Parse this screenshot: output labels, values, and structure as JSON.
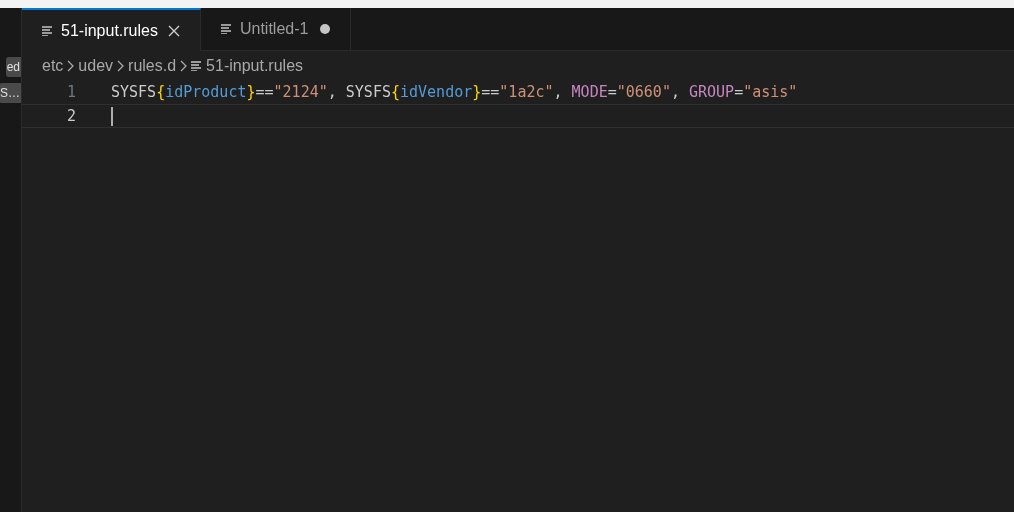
{
  "sidebar": {
    "badges": [
      "ed",
      "S…"
    ]
  },
  "tabs": [
    {
      "label": "51-input.rules",
      "selected": true,
      "modified": false
    },
    {
      "label": "Untitled-1",
      "selected": false,
      "modified": true
    }
  ],
  "breadcrumbs": [
    "etc",
    "udev",
    "rules.d",
    "51-input.rules"
  ],
  "lines": [
    {
      "number": "1",
      "current": false,
      "tokens": [
        {
          "kind": "plain",
          "text": "SYSFS"
        },
        {
          "kind": "brace",
          "text": "{"
        },
        {
          "kind": "key",
          "text": "idProduct"
        },
        {
          "kind": "brace",
          "text": "}"
        },
        {
          "kind": "plain",
          "text": "=="
        },
        {
          "kind": "string",
          "text": "\"2124\""
        },
        {
          "kind": "plain",
          "text": ", SYSFS"
        },
        {
          "kind": "brace",
          "text": "{"
        },
        {
          "kind": "key",
          "text": "idVendor"
        },
        {
          "kind": "brace",
          "text": "}"
        },
        {
          "kind": "plain",
          "text": "=="
        },
        {
          "kind": "string",
          "text": "\"1a2c\""
        },
        {
          "kind": "plain",
          "text": ", "
        },
        {
          "kind": "keyword",
          "text": "MODE"
        },
        {
          "kind": "plain",
          "text": "="
        },
        {
          "kind": "string",
          "text": "\"0660\""
        },
        {
          "kind": "plain",
          "text": ", "
        },
        {
          "kind": "keyword",
          "text": "GROUP"
        },
        {
          "kind": "plain",
          "text": "="
        },
        {
          "kind": "string",
          "text": "\"asis\""
        }
      ]
    },
    {
      "number": "2",
      "current": true
    }
  ]
}
